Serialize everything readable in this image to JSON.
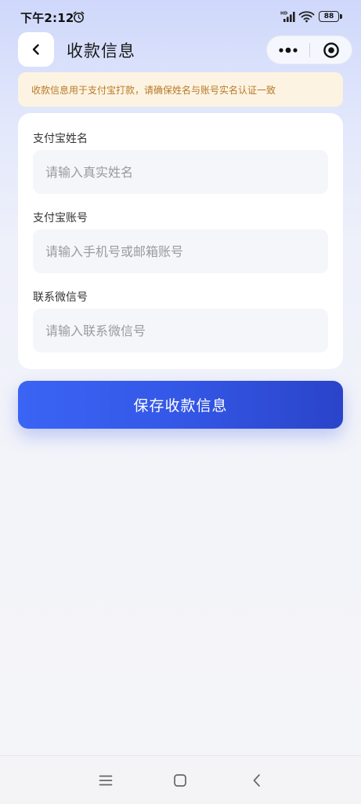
{
  "status_bar": {
    "time": "下午2:12",
    "network_badge": "HD",
    "battery_level": "88",
    "icons": [
      "alarm-icon",
      "signal-icon",
      "wifi-icon",
      "battery-icon"
    ]
  },
  "header": {
    "title": "收款信息",
    "back_icon": "chevron-left-icon",
    "more_icon": "more-dots-icon",
    "close_icon": "target-circle-icon"
  },
  "notice": {
    "text": "收款信息用于支付宝打款，请确保姓名与账号实名认证一致",
    "color": "#b77b2a",
    "background": "#fdf3e2"
  },
  "form": {
    "fields": [
      {
        "label": "支付宝姓名",
        "value": "",
        "placeholder": "请输入真实姓名"
      },
      {
        "label": "支付宝账号",
        "value": "",
        "placeholder": "请输入手机号或邮箱账号"
      },
      {
        "label": "联系微信号",
        "value": "",
        "placeholder": "请输入联系微信号"
      }
    ]
  },
  "save_button": {
    "label": "保存收款信息",
    "color": "#3457e6"
  },
  "nav_bar": {
    "icons": [
      "menu-icon",
      "home-square-icon",
      "back-chevron-icon"
    ]
  }
}
